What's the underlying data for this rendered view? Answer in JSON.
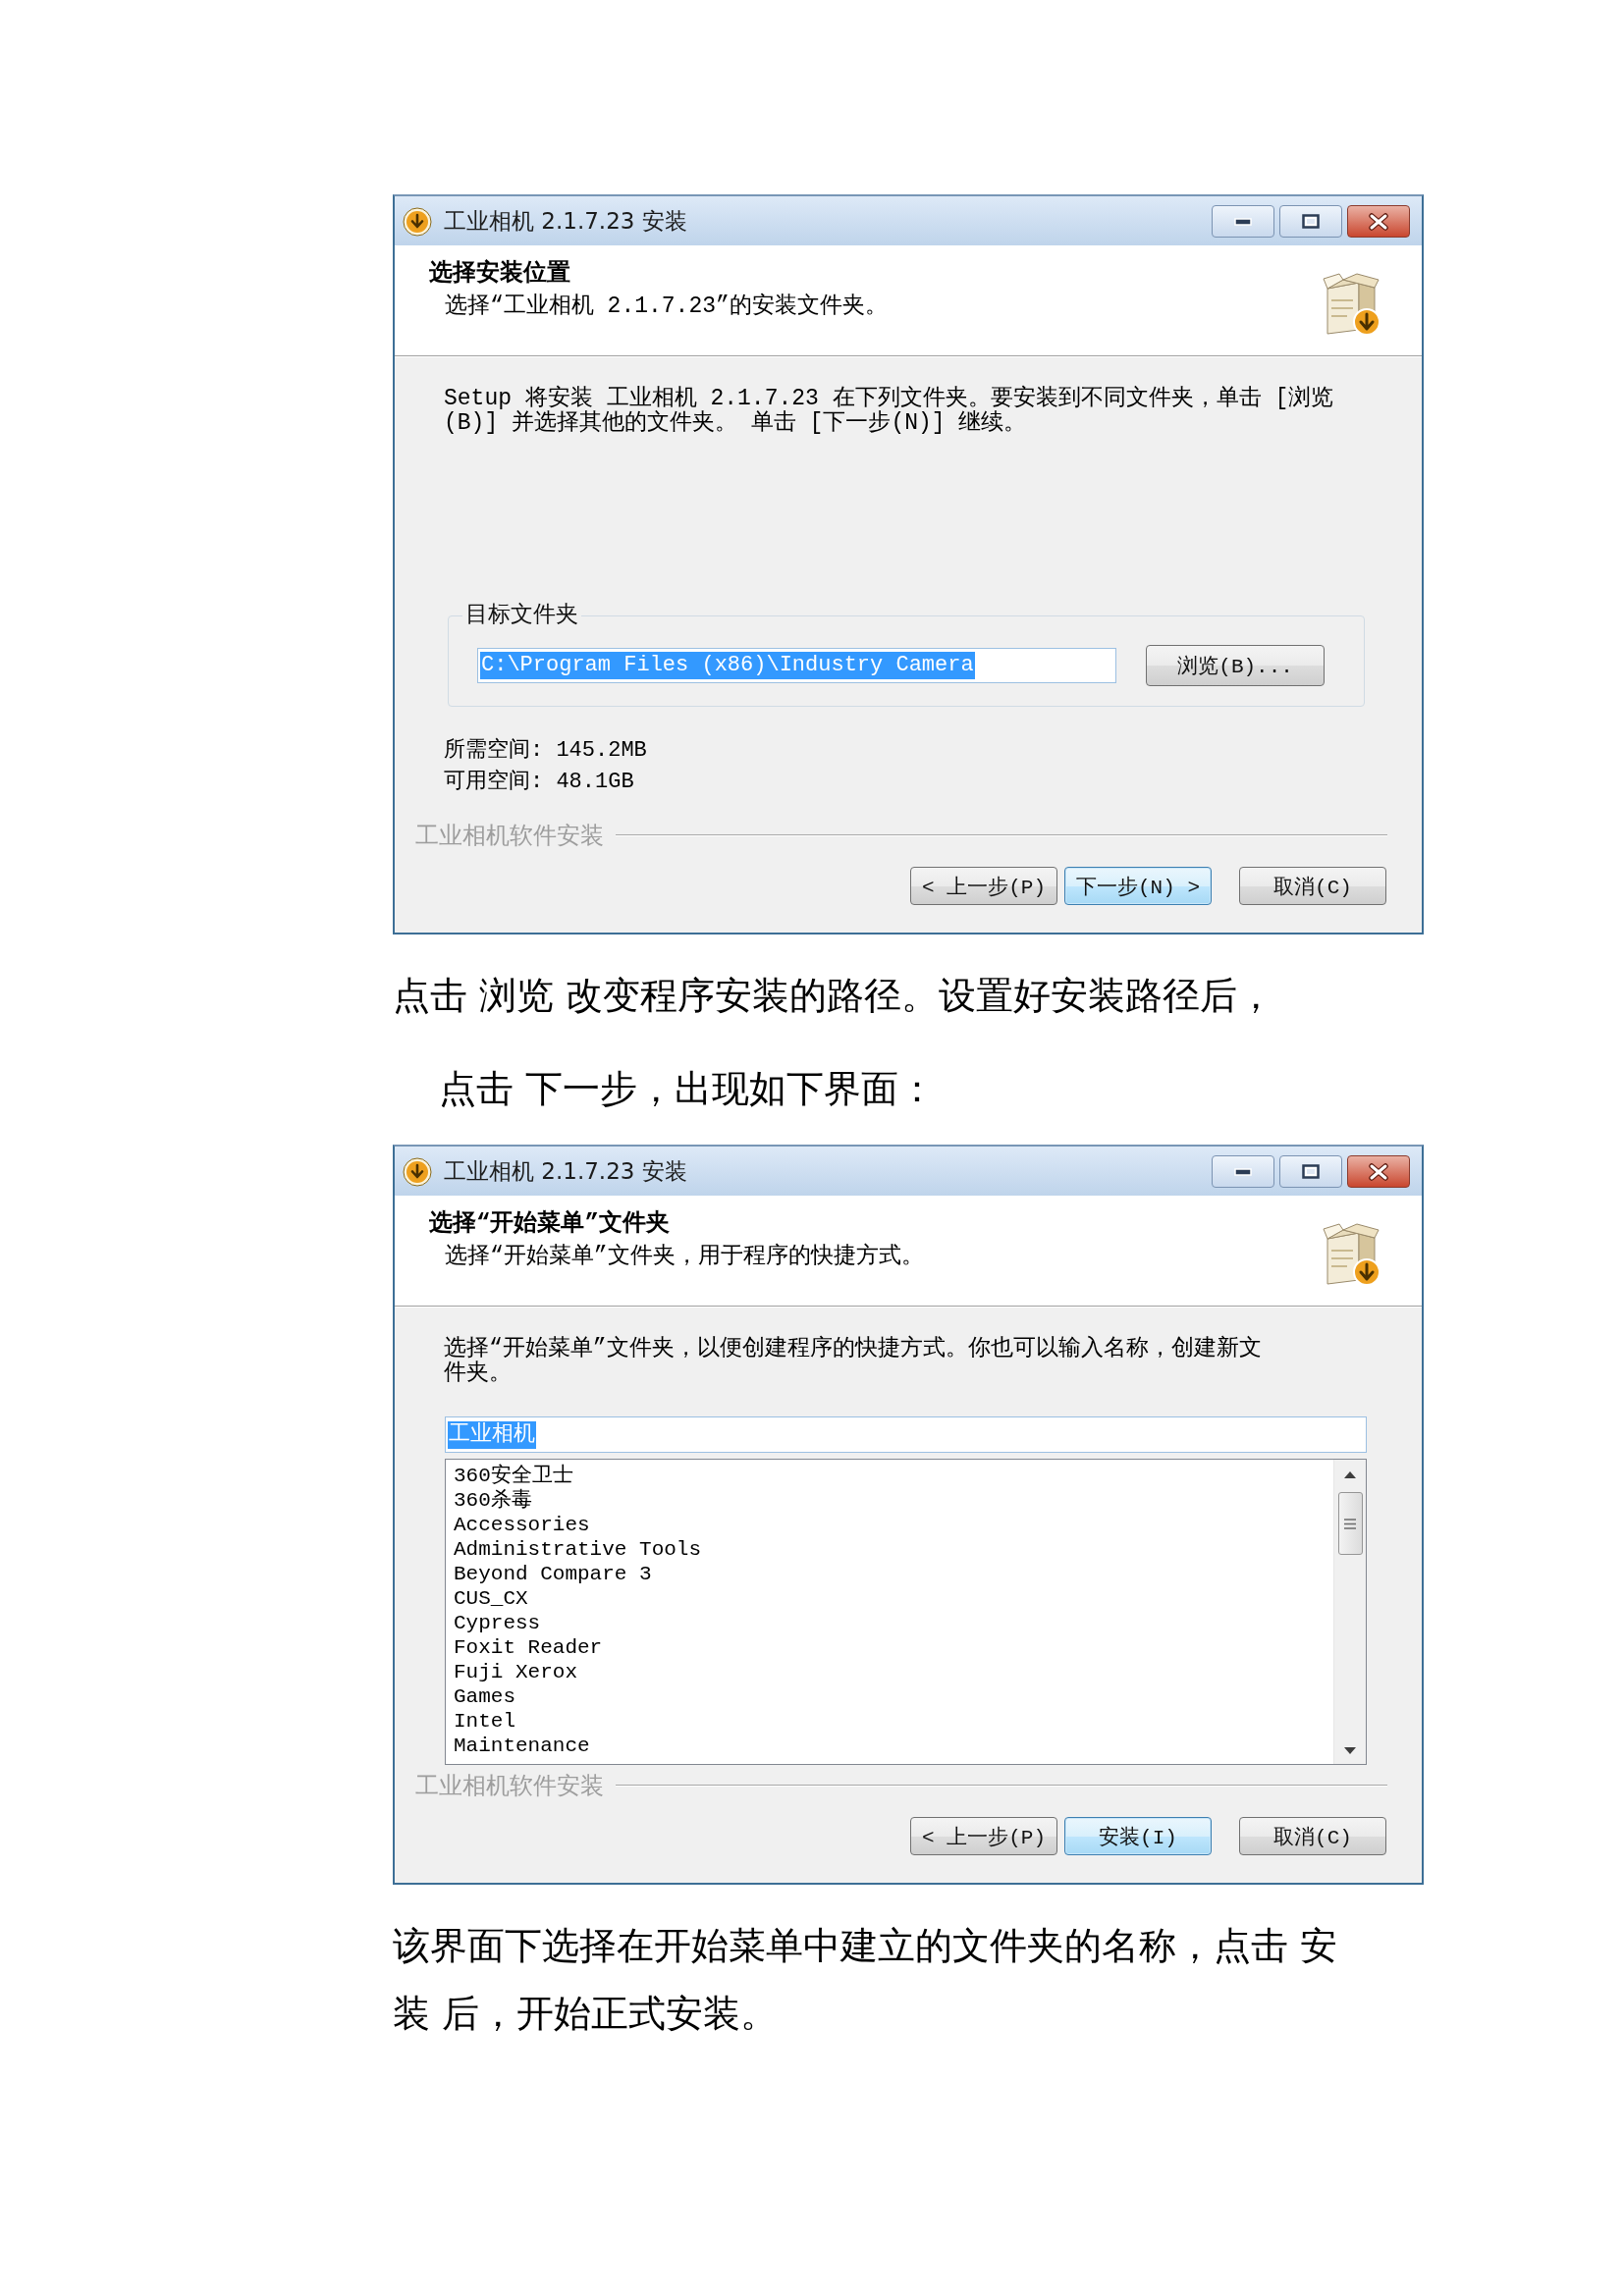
{
  "blocks": [
    {
      "kind": "dialog",
      "window": {
        "title": "工业相机 2.1.7.23 安装"
      },
      "header": {
        "title": "选择安装位置",
        "subtitle": "选择“工业相机 2.1.7.23”的安装文件夹。"
      },
      "page": {
        "kind": "directory",
        "description": "Setup 将安装 工业相机 2.1.7.23 在下列文件夹。要安装到不同文件夹，单击 [浏览(B)] 并选择其他的文件夹。 单击 [下一步(N)] 继续。",
        "group_label": "目标文件夹",
        "path_field": {
          "value": "C:\\Program Files (x86)\\Industry Camera",
          "text_selected": true
        },
        "browse_button": "浏览(B)...",
        "space_info": [
          "所需空间: 145.2MB",
          "可用空间: 48.1GB"
        ]
      },
      "branding": "工业相机软件安装",
      "buttons": [
        {
          "label": "< 上一步(P)",
          "default": false
        },
        {
          "label": "下一步(N) >",
          "default": true
        },
        {
          "label": "取消(C)",
          "default": false
        }
      ]
    },
    {
      "kind": "paragraph",
      "text": "点击 浏览 改变程序安装的路径。设置好安装路径后，",
      "indented": false
    },
    {
      "kind": "paragraph",
      "text": "点击 下一步，出现如下界面：",
      "indented": true
    },
    {
      "kind": "dialog",
      "window": {
        "title": "工业相机 2.1.7.23 安装"
      },
      "header": {
        "title": "选择“开始菜单”文件夹",
        "subtitle": "选择“开始菜单”文件夹，用于程序的快捷方式。"
      },
      "page": {
        "kind": "startmenu",
        "description": "选择“开始菜单”文件夹，以便创建程序的快捷方式。你也可以输入名称，创建新文件夹。",
        "folder_field": {
          "value": "工业相机",
          "text_selected": true
        },
        "folder_list": [
          "360安全卫士",
          "360杀毒",
          "Accessories",
          "Administrative Tools",
          "Beyond Compare 3",
          "CUS_CX",
          "Cypress",
          "Foxit Reader",
          "Fuji Xerox",
          "Games",
          "Intel",
          "Maintenance"
        ]
      },
      "branding": "工业相机软件安装",
      "buttons": [
        {
          "label": "< 上一步(P)",
          "default": false
        },
        {
          "label": "安装(I)",
          "default": true
        },
        {
          "label": "取消(C)",
          "default": false
        }
      ]
    },
    {
      "kind": "paragraph",
      "text": "该界面下选择在开始菜单中建立的文件夹的名称，点击 安装 后，开始正式安装。",
      "indented": false
    }
  ]
}
